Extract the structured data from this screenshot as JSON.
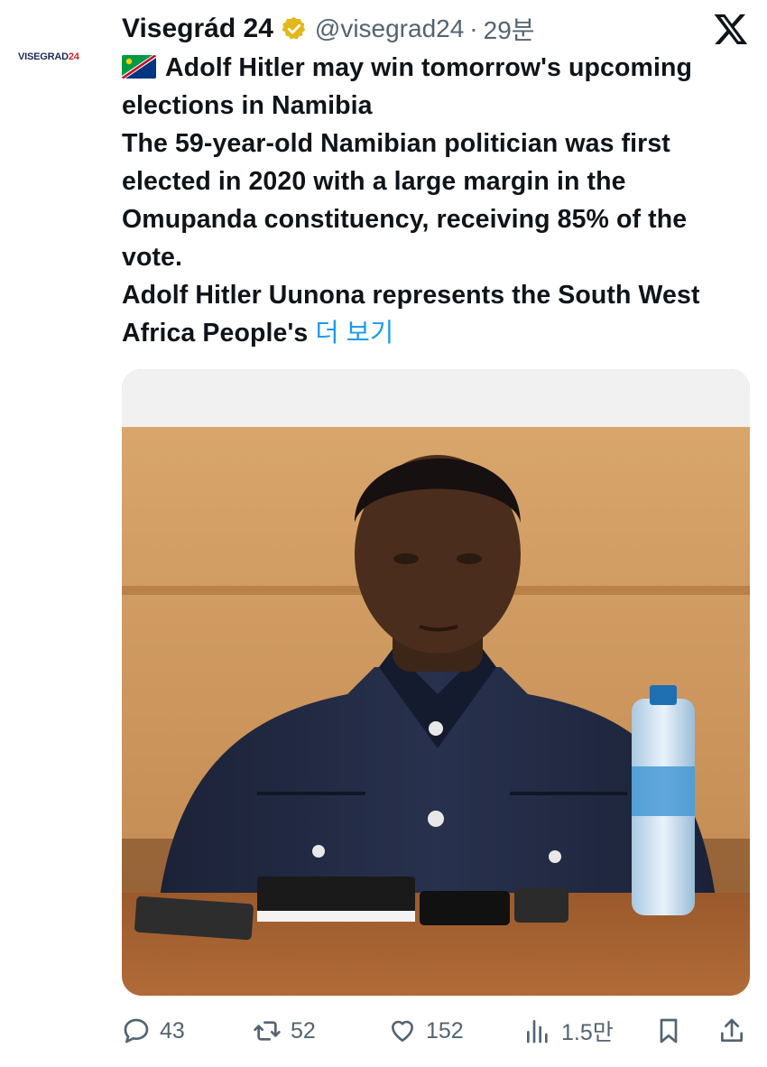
{
  "account": {
    "avatar_text": "VISEGRAD",
    "avatar_text_num": "24",
    "name": "Visegrád 24",
    "handle": "@visegrad24",
    "separator": "·",
    "time": "29분"
  },
  "tweet": {
    "line1": "Adolf Hitler may win tomorrow's upcoming elections in Namibia",
    "line2": "The 59-year-old Namibian politician was first elected in 2020 with a large margin in the Omupanda constituency, receiving 85% of the vote.",
    "line3": "Adolf Hitler Uunona represents the South West Africa People's",
    "more_label": "더 보기"
  },
  "metrics": {
    "replies": "43",
    "reposts": "52",
    "likes": "152",
    "views": "1.5만"
  },
  "icons": {
    "verified": "verified-badge-icon",
    "platform": "x-logo-icon",
    "flag": "namibia-flag-icon",
    "reply": "reply-icon",
    "repost": "repost-icon",
    "like": "heart-icon",
    "views": "views-icon",
    "bookmark": "bookmark-icon",
    "share": "share-icon"
  },
  "colors": {
    "link": "#1d9bf0",
    "muted": "#536471",
    "verified_gold": "#e2b719"
  }
}
